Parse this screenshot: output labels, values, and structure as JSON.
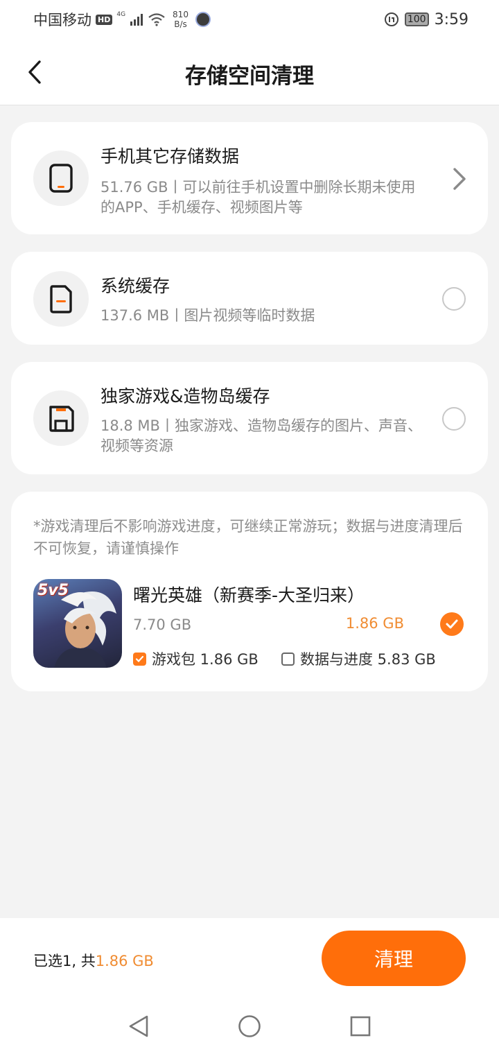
{
  "status": {
    "carrier": "中国移动",
    "hd": "HD",
    "net": "4G",
    "speed_value": "810",
    "speed_unit": "B/s",
    "battery": "100",
    "time": "3:59"
  },
  "header": {
    "title": "存储空间清理"
  },
  "cards": [
    {
      "title": "手机其它存储数据",
      "desc": "51.76 GB丨可以前往手机设置中删除长期未使用的APP、手机缓存、视频图片等",
      "action": "chevron"
    },
    {
      "title": "系统缓存",
      "desc": "137.6 MB丨图片视频等临时数据",
      "action": "radio"
    },
    {
      "title": "独家游戏&造物岛缓存",
      "desc": "18.8 MB丨独家游戏、造物岛缓存的图片、声音、视频等资源",
      "action": "radio"
    }
  ],
  "game_section": {
    "notice": "*游戏清理后不影响游戏进度，可继续正常游玩；数据与进度清理后不可恢复，请谨慎操作",
    "game": {
      "icon_badge": "5v5",
      "name": "曙光英雄（新赛季-大圣归来）",
      "total_size": "7.70 GB",
      "selected_size": "1.86 GB",
      "checked": true,
      "options": [
        {
          "label": "游戏包 1.86 GB",
          "checked": true
        },
        {
          "label": "数据与进度 5.83 GB",
          "checked": false
        }
      ]
    }
  },
  "bottom": {
    "summary_prefix": "已选1, 共",
    "summary_size": "1.86 GB",
    "clean_label": "清理"
  },
  "colors": {
    "accent": "#ff6e0a",
    "accent_text": "#f08c32"
  },
  "nav": [
    "back-triangle-icon",
    "home-circle-icon",
    "recents-square-icon"
  ]
}
